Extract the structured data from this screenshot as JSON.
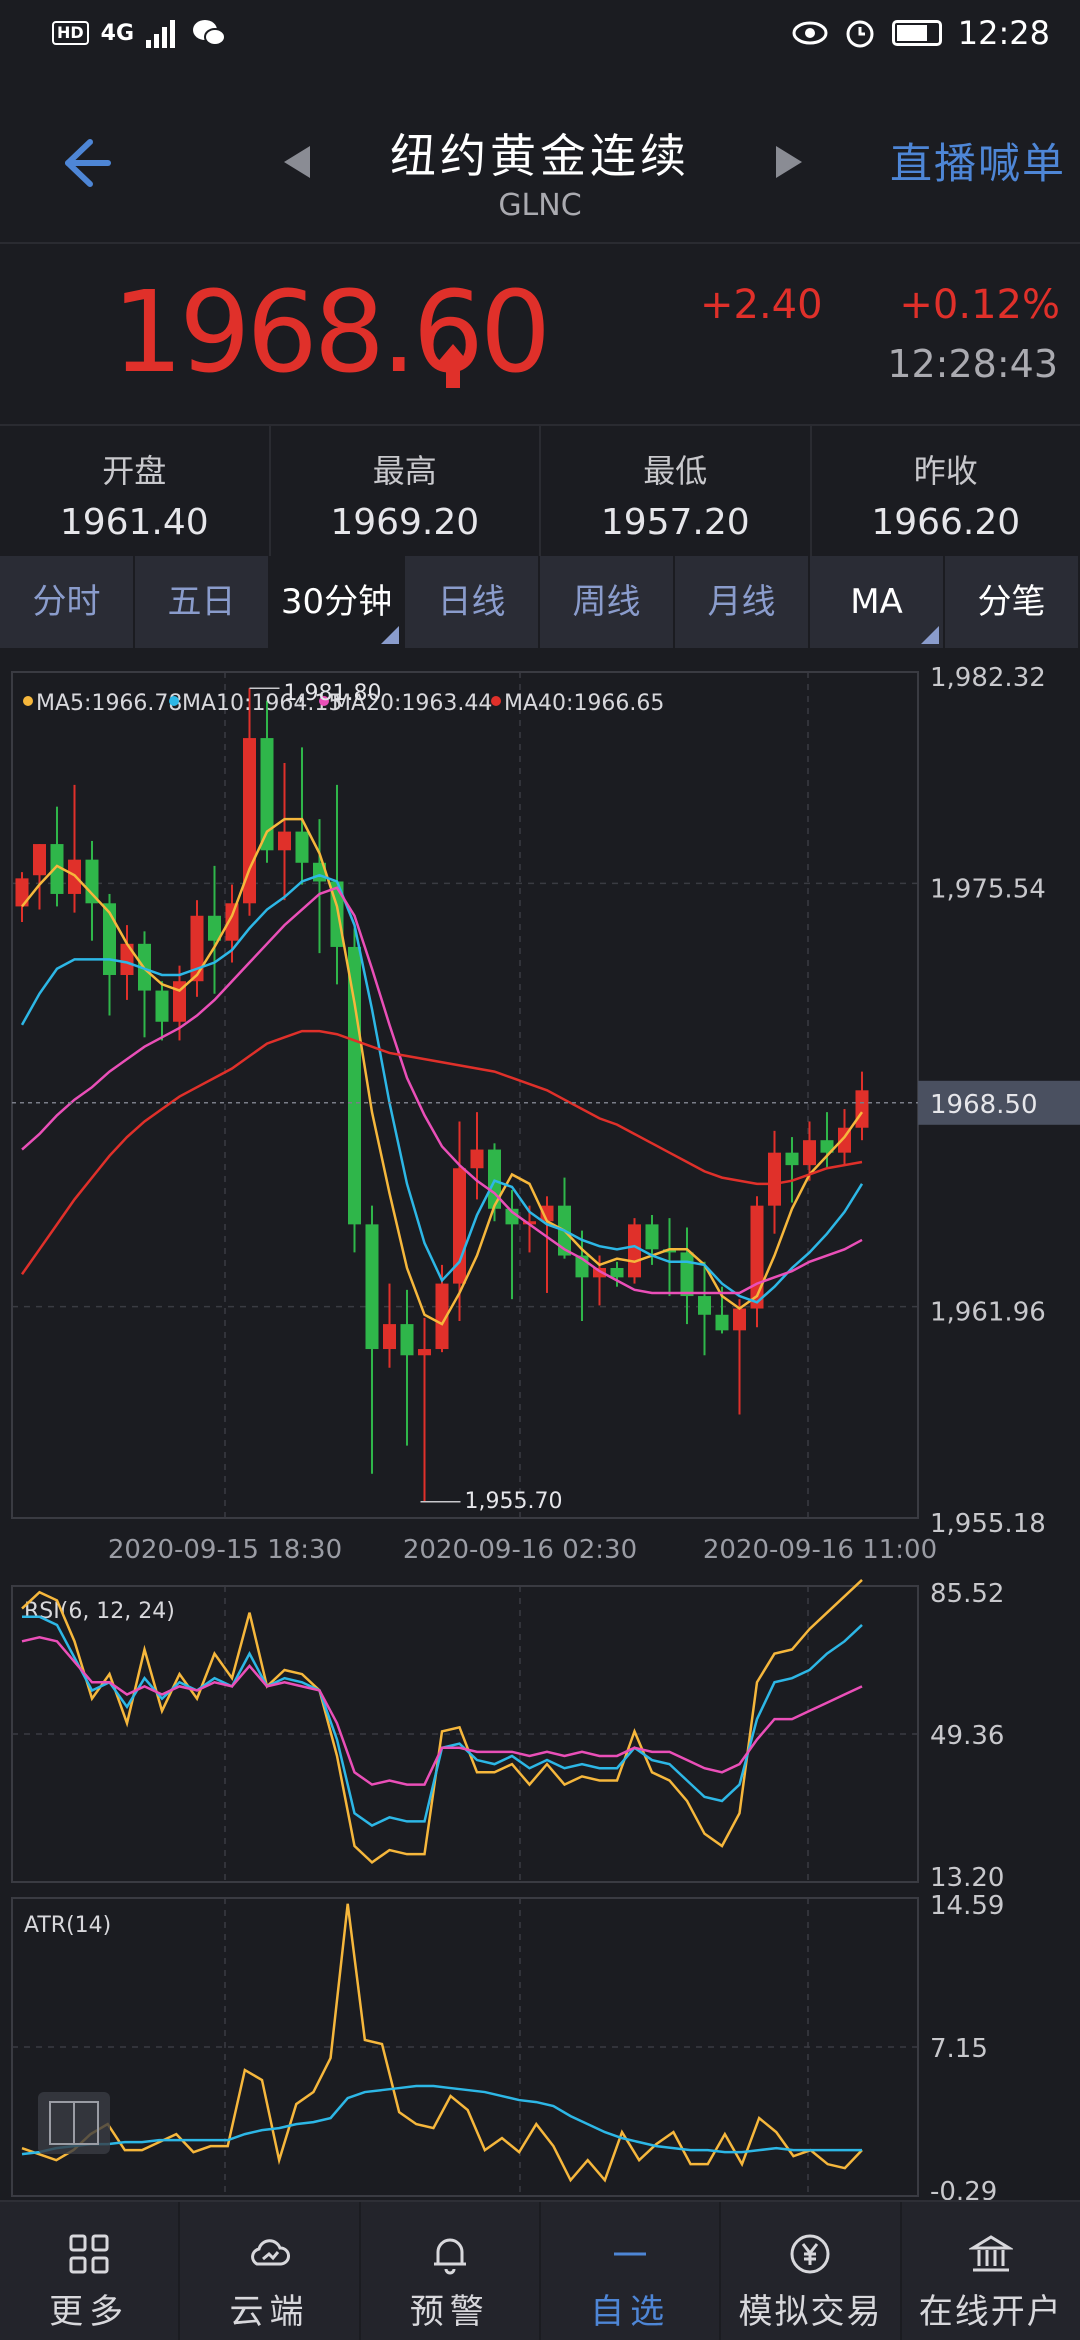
{
  "status_bar": {
    "network": "4G",
    "hd": "HD",
    "time": "12:28"
  },
  "header": {
    "title": "纽约黄金连续",
    "code": "GLNC",
    "live_label": "直播喊单"
  },
  "quote": {
    "price": "1968.60",
    "change": "+2.40",
    "change_pct": "+0.12%",
    "time": "12:28:43",
    "colors": {
      "up": "#e0302a"
    }
  },
  "stats": [
    {
      "label": "开盘",
      "value": "1961.40"
    },
    {
      "label": "最高",
      "value": "1969.20"
    },
    {
      "label": "最低",
      "value": "1957.20"
    },
    {
      "label": "昨收",
      "value": "1966.20"
    }
  ],
  "tabs": [
    {
      "label": "分时"
    },
    {
      "label": "五日"
    },
    {
      "label": "30分钟",
      "active": true
    },
    {
      "label": "日线"
    },
    {
      "label": "周线"
    },
    {
      "label": "月线"
    },
    {
      "label": "MA"
    },
    {
      "label": "分笔"
    }
  ],
  "chart_data": [
    {
      "type": "candlestick",
      "legend": [
        "MA5:1966.78",
        "MA10:1964.15",
        "MA20:1963.44",
        "MA40:1966.65"
      ],
      "legend_colors": [
        "#f6b73c",
        "#2db7e6",
        "#ea4fb8",
        "#e0302a"
      ],
      "y_ticks": [
        "1,982.32",
        "1,975.54",
        "1,961.96",
        "1,955.18"
      ],
      "ylim": [
        1955.18,
        1982.32
      ],
      "x_ticks": [
        "2020-09-15 18:30",
        "2020-09-16 02:30",
        "2020-09-16 11:00"
      ],
      "high_label": "1,981.80",
      "low_label": "1,955.70",
      "current_label": "1968.50",
      "candles": [
        [
          1974.8,
          1975.7,
          1974.3,
          1975.9
        ],
        [
          1975.8,
          1976.8,
          1974.7,
          1976.8
        ],
        [
          1976.8,
          1975.2,
          1974.8,
          1978.0
        ],
        [
          1975.2,
          1976.3,
          1974.6,
          1978.7
        ],
        [
          1976.3,
          1974.9,
          1973.7,
          1976.9
        ],
        [
          1974.9,
          1972.6,
          1971.3,
          1975.2
        ],
        [
          1972.6,
          1973.6,
          1971.8,
          1974.2
        ],
        [
          1973.6,
          1972.1,
          1970.6,
          1974.0
        ],
        [
          1972.1,
          1971.1,
          1970.5,
          1972.4
        ],
        [
          1971.1,
          1972.4,
          1970.5,
          1972.9
        ],
        [
          1972.4,
          1974.5,
          1971.9,
          1975.0
        ],
        [
          1974.5,
          1973.7,
          1972.0,
          1976.1
        ],
        [
          1973.7,
          1974.9,
          1973.0,
          1975.5
        ],
        [
          1974.9,
          1980.2,
          1974.5,
          1981.8
        ],
        [
          1980.2,
          1976.6,
          1976.2,
          1981.4
        ],
        [
          1976.6,
          1977.2,
          1975.0,
          1979.4
        ],
        [
          1977.2,
          1976.2,
          1975.5,
          1979.9
        ],
        [
          1976.2,
          1975.6,
          1973.3,
          1977.6
        ],
        [
          1975.6,
          1973.5,
          1972.3,
          1978.7
        ],
        [
          1973.5,
          1964.6,
          1963.7,
          1974.1
        ],
        [
          1964.6,
          1960.6,
          1956.6,
          1965.2
        ],
        [
          1960.6,
          1961.4,
          1960.0,
          1962.7
        ],
        [
          1961.4,
          1960.4,
          1957.5,
          1962.5
        ],
        [
          1960.4,
          1960.6,
          1955.7,
          1961.6
        ],
        [
          1960.6,
          1962.7,
          1960.5,
          1963.3
        ],
        [
          1962.7,
          1966.4,
          1961.5,
          1967.9
        ],
        [
          1966.4,
          1967.0,
          1965.4,
          1968.2
        ],
        [
          1967.0,
          1965.1,
          1964.7,
          1967.2
        ],
        [
          1965.1,
          1964.6,
          1962.2,
          1965.7
        ],
        [
          1964.6,
          1964.7,
          1963.7,
          1965.2
        ],
        [
          1964.7,
          1965.2,
          1962.4,
          1965.5
        ],
        [
          1965.2,
          1963.6,
          1963.5,
          1966.1
        ],
        [
          1963.6,
          1962.9,
          1961.5,
          1964.4
        ],
        [
          1962.9,
          1963.2,
          1962.0,
          1963.6
        ],
        [
          1963.2,
          1962.9,
          1962.6,
          1963.4
        ],
        [
          1962.9,
          1964.6,
          1962.7,
          1964.8
        ],
        [
          1964.6,
          1963.8,
          1963.3,
          1964.9
        ],
        [
          1963.8,
          1963.7,
          1962.3,
          1964.8
        ],
        [
          1963.7,
          1962.3,
          1961.4,
          1964.5
        ],
        [
          1962.3,
          1961.7,
          1960.4,
          1963.4
        ],
        [
          1961.7,
          1961.2,
          1961.1,
          1962.6
        ],
        [
          1961.2,
          1961.9,
          1958.5,
          1962.2
        ],
        [
          1961.9,
          1965.2,
          1961.3,
          1965.5
        ],
        [
          1965.2,
          1966.9,
          1964.3,
          1967.6
        ],
        [
          1966.9,
          1966.5,
          1965.3,
          1967.4
        ],
        [
          1966.5,
          1967.3,
          1966.0,
          1967.9
        ],
        [
          1967.3,
          1966.9,
          1966.4,
          1968.2
        ],
        [
          1966.9,
          1967.7,
          1966.5,
          1968.3
        ],
        [
          1967.7,
          1968.9,
          1967.3,
          1969.5
        ]
      ],
      "ma5": [
        1974.8,
        1975.5,
        1976.1,
        1975.8,
        1975.2,
        1974.6,
        1973.6,
        1972.8,
        1972.3,
        1972.1,
        1972.6,
        1973.5,
        1974.5,
        1976.0,
        1977.2,
        1977.6,
        1977.6,
        1976.5,
        1974.8,
        1971.7,
        1968.2,
        1965.6,
        1963.2,
        1961.7,
        1961.4,
        1962.4,
        1963.6,
        1965.2,
        1966.2,
        1965.9,
        1964.7,
        1964.4,
        1963.8,
        1963.3,
        1963.5,
        1963.4,
        1963.6,
        1963.8,
        1963.8,
        1963.3,
        1962.3,
        1961.9,
        1962.3,
        1963.6,
        1965.1,
        1966.2,
        1966.8,
        1967.4,
        1968.2
      ],
      "ma10": [
        1971.0,
        1972.0,
        1972.8,
        1973.1,
        1973.1,
        1973.1,
        1973.0,
        1972.8,
        1972.6,
        1972.6,
        1972.8,
        1973.0,
        1973.4,
        1974.1,
        1974.7,
        1975.1,
        1975.6,
        1975.8,
        1975.6,
        1974.2,
        1971.5,
        1968.5,
        1965.9,
        1964.0,
        1962.8,
        1963.4,
        1964.9,
        1966.0,
        1965.8,
        1965.0,
        1964.6,
        1964.4,
        1964.1,
        1963.9,
        1963.8,
        1963.9,
        1963.6,
        1963.4,
        1963.4,
        1963.3,
        1962.7,
        1962.3,
        1962.1,
        1962.6,
        1963.2,
        1963.7,
        1964.3,
        1965.0,
        1965.9
      ],
      "ma20": [
        1967.0,
        1967.5,
        1968.1,
        1968.6,
        1969.0,
        1969.5,
        1969.9,
        1970.3,
        1970.6,
        1970.9,
        1971.3,
        1971.8,
        1972.4,
        1973.0,
        1973.6,
        1974.2,
        1974.7,
        1975.2,
        1975.4,
        1974.5,
        1972.8,
        1971.0,
        1969.3,
        1968.1,
        1967.1,
        1966.5,
        1966.0,
        1965.6,
        1965.0,
        1964.6,
        1964.2,
        1963.8,
        1963.5,
        1963.1,
        1962.8,
        1962.5,
        1962.4,
        1962.4,
        1962.4,
        1962.4,
        1962.4,
        1962.4,
        1962.7,
        1962.9,
        1963.1,
        1963.4,
        1963.6,
        1963.8,
        1964.1
      ],
      "ma40": [
        1963.0,
        1963.8,
        1964.6,
        1965.4,
        1966.1,
        1966.8,
        1967.4,
        1967.9,
        1968.3,
        1968.7,
        1969.0,
        1969.3,
        1969.6,
        1970.0,
        1970.4,
        1970.6,
        1970.8,
        1970.8,
        1970.7,
        1970.5,
        1970.3,
        1970.1,
        1970.0,
        1969.9,
        1969.8,
        1969.7,
        1969.6,
        1969.5,
        1969.3,
        1969.1,
        1968.9,
        1968.6,
        1968.3,
        1968.0,
        1967.8,
        1967.5,
        1967.2,
        1966.9,
        1966.6,
        1966.3,
        1966.1,
        1966.0,
        1965.9,
        1965.9,
        1966.0,
        1966.2,
        1966.4,
        1966.5,
        1966.6
      ]
    },
    {
      "type": "line",
      "label": "RSI(6, 12, 24)",
      "y_ticks": [
        "85.52",
        "49.36",
        "13.20"
      ],
      "ylim": [
        13.2,
        85.52
      ],
      "series": [
        {
          "values": [
            80,
            84,
            82,
            72,
            58,
            64,
            52,
            70,
            55,
            64,
            58,
            69,
            63,
            79,
            61,
            65,
            64,
            60,
            44,
            22,
            18,
            21,
            20,
            20,
            50,
            51,
            40,
            40,
            42,
            37,
            42,
            37,
            39,
            38,
            38,
            50,
            40,
            38,
            33,
            25,
            22,
            30,
            62,
            69,
            70,
            75,
            79,
            83,
            87
          ]
        },
        {
          "values": [
            78,
            78,
            76,
            68,
            60,
            62,
            56,
            63,
            58,
            62,
            60,
            63,
            61,
            69,
            61,
            63,
            62,
            60,
            48,
            30,
            27,
            29,
            28,
            28,
            46,
            47,
            43,
            42,
            44,
            41,
            43,
            41,
            42,
            41,
            41,
            46,
            43,
            42,
            38,
            34,
            33,
            37,
            53,
            62,
            63,
            65,
            69,
            72,
            76
          ]
        },
        {
          "values": [
            72,
            73,
            72,
            67,
            62,
            62,
            59,
            61,
            59,
            61,
            60,
            62,
            61,
            66,
            61,
            62,
            61,
            60,
            52,
            40,
            37,
            38,
            37,
            37,
            46,
            46,
            45,
            45,
            45,
            44,
            45,
            44,
            45,
            44,
            44,
            46,
            45,
            45,
            43,
            41,
            40,
            42,
            48,
            53,
            53,
            55,
            57,
            59,
            61
          ]
        }
      ],
      "colors": [
        "#f6b73c",
        "#2db7e6",
        "#ea4fb8"
      ]
    },
    {
      "type": "line",
      "label": "ATR(14)",
      "y_ticks": [
        "14.59",
        "7.15",
        "-0.29"
      ],
      "ylim": [
        -0.29,
        14.59
      ],
      "series": [
        {
          "values": [
            2.1,
            1.8,
            1.5,
            2.0,
            2.8,
            3.3,
            2.0,
            2.0,
            2.4,
            2.8,
            1.9,
            2.2,
            2.2,
            6.0,
            5.5,
            1.5,
            4.3,
            4.9,
            6.6,
            14.3,
            7.5,
            7.3,
            3.9,
            3.3,
            3.1,
            4.7,
            4.0,
            2.0,
            2.6,
            1.9,
            3.3,
            2.2,
            0.5,
            1.5,
            0.5,
            2.9,
            1.5,
            2.3,
            2.9,
            1.3,
            1.3,
            2.8,
            1.3,
            3.6,
            2.9,
            1.7,
            2.0,
            1.3,
            1.1,
            2.0
          ]
        },
        {
          "values": [
            1.8,
            1.9,
            2.1,
            2.2,
            2.3,
            2.3,
            2.4,
            2.4,
            2.5,
            2.5,
            2.5,
            2.5,
            2.5,
            2.8,
            3.0,
            3.1,
            3.3,
            3.4,
            3.6,
            4.6,
            4.9,
            5.0,
            5.1,
            5.2,
            5.2,
            5.1,
            5.0,
            4.9,
            4.7,
            4.5,
            4.4,
            4.2,
            3.7,
            3.3,
            2.9,
            2.6,
            2.4,
            2.2,
            2.1,
            2.0,
            2.0,
            1.9,
            1.9,
            2.0,
            2.1,
            2.0,
            2.0,
            2.0,
            2.0,
            2.0
          ]
        }
      ],
      "colors": [
        "#f6b73c",
        "#2db7e6"
      ]
    }
  ],
  "bottom_nav": [
    {
      "label": "更多",
      "icon": "grid-icon"
    },
    {
      "label": "云端",
      "icon": "cloud-icon"
    },
    {
      "label": "预警",
      "icon": "bell-icon"
    },
    {
      "label": "自选",
      "icon": "dash-icon",
      "active": true
    },
    {
      "label": "模拟交易",
      "icon": "yen-icon"
    },
    {
      "label": "在线开户",
      "icon": "bank-icon"
    }
  ]
}
